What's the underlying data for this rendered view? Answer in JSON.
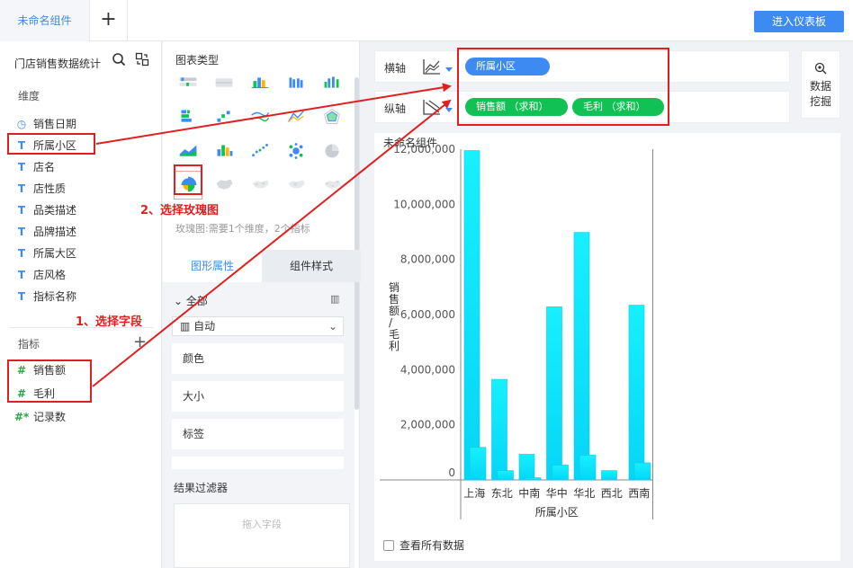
{
  "tabs": {
    "active_label": "未命名组件",
    "add_label": "+"
  },
  "toolbar": {
    "enter_dashboard": "进入仪表板"
  },
  "datasource": {
    "title": "门店销售数据统计"
  },
  "dimensions": {
    "title": "维度",
    "items": [
      {
        "icon": "clock-icon",
        "glyph": "◷",
        "label": "销售日期"
      },
      {
        "icon": "text-type-icon",
        "glyph": "T",
        "label": "所属小区"
      },
      {
        "icon": "text-type-icon",
        "glyph": "T",
        "label": "店名"
      },
      {
        "icon": "text-type-icon",
        "glyph": "T",
        "label": "店性质"
      },
      {
        "icon": "text-type-icon",
        "glyph": "T",
        "label": "品类描述"
      },
      {
        "icon": "text-type-icon",
        "glyph": "T",
        "label": "品牌描述"
      },
      {
        "icon": "text-type-icon",
        "glyph": "T",
        "label": "所属大区"
      },
      {
        "icon": "text-type-icon",
        "glyph": "T",
        "label": "店风格"
      },
      {
        "icon": "text-type-icon",
        "glyph": "T",
        "label": "指标名称"
      }
    ]
  },
  "measures": {
    "title": "指标",
    "add_label": "+",
    "items": [
      {
        "icon": "number-type-icon",
        "glyph": "#",
        "label": "销售额"
      },
      {
        "icon": "number-type-icon",
        "glyph": "#",
        "label": "毛利"
      },
      {
        "icon": "record-count-icon",
        "glyph": "#*",
        "label": "记录数"
      }
    ]
  },
  "chart_types": {
    "title": "图表类型",
    "tip": "玫瑰图:需要1个维度，2个指标",
    "selected": "rose-chart"
  },
  "properties": {
    "tab_shape": "图形属性",
    "tab_style": "组件样式",
    "all_label": "全部",
    "auto_label": "自动",
    "items": [
      "颜色",
      "大小",
      "标签"
    ]
  },
  "filter": {
    "title": "结果过滤器",
    "placeholder": "拖入字段"
  },
  "axes": {
    "x_label": "横轴",
    "y_label": "纵轴",
    "x_fields": [
      "所属小区"
    ],
    "y_fields": [
      "销售额 （求和）",
      "毛利 （求和）"
    ]
  },
  "data_mining": {
    "line1": "数据",
    "line2": "挖掘"
  },
  "chart_card": {
    "title": "未命名组件",
    "check_all": "查看所有数据"
  },
  "annotations": {
    "step1": "1、选择字段",
    "step2": "2、选择玫瑰图"
  },
  "colors": {
    "accent": "#3d8bf2",
    "measure_pill": "#12c153",
    "bar": "#17e8ff",
    "annotation": "#e02020"
  },
  "chart_data": {
    "type": "bar",
    "categories": [
      "上海",
      "东北",
      "中南",
      "华中",
      "华北",
      "西北",
      "西南"
    ],
    "series": [
      {
        "name": "销售额",
        "values": [
          11950000,
          3650000,
          930000,
          6280000,
          8980000,
          340000,
          6340000
        ]
      },
      {
        "name": "毛利",
        "values": [
          1180000,
          340000,
          80000,
          540000,
          900000,
          0,
          620000
        ]
      }
    ],
    "xlabel": "所属小区",
    "ylabel": "销售额/毛利",
    "ylim": [
      0,
      12000000
    ],
    "yticks": [
      "0",
      "2,000,000",
      "4,000,000",
      "6,000,000",
      "8,000,000",
      "10,000,000",
      "12,000,000"
    ],
    "ytick_values": [
      0,
      2000000,
      4000000,
      6000000,
      8000000,
      10000000,
      12000000
    ],
    "grid": false
  }
}
